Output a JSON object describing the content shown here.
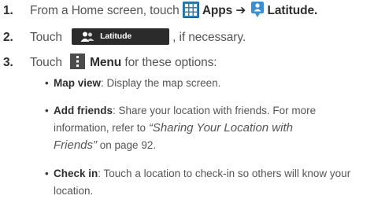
{
  "steps": [
    {
      "number": "1.",
      "text_before": "From a Home screen, touch ",
      "apps_label": "Apps",
      "arrow": "➔",
      "latitude_label": "Latitude",
      "end": "."
    },
    {
      "number": "2.",
      "text_before": "Touch",
      "button_label": "Latitude",
      "text_after": ", if necessary."
    },
    {
      "number": "3.",
      "text_before": "Touch",
      "menu_label": "Menu",
      "text_after": " for these options:"
    }
  ],
  "options": [
    {
      "term": "Map view",
      "desc": ": Display the map screen."
    },
    {
      "term": "Add friends",
      "desc": ": Share your location with friends. For more",
      "line2": "information, refer to ",
      "ref": "“Sharing Your Location with",
      "line3_ref": "Friends”",
      "line3_rest": " on page 92."
    },
    {
      "term": "Check in",
      "desc": ": Touch a location to check-in so others will know your",
      "line2": "location."
    }
  ],
  "colors": {
    "text": "#555555",
    "apps_icon": "#2f7fb8",
    "button_bg": "#2b2b2b",
    "pin": "#3b8fd0"
  },
  "icons": [
    "apps-grid-icon",
    "latitude-pin-icon",
    "people-icon",
    "menu-icon"
  ]
}
